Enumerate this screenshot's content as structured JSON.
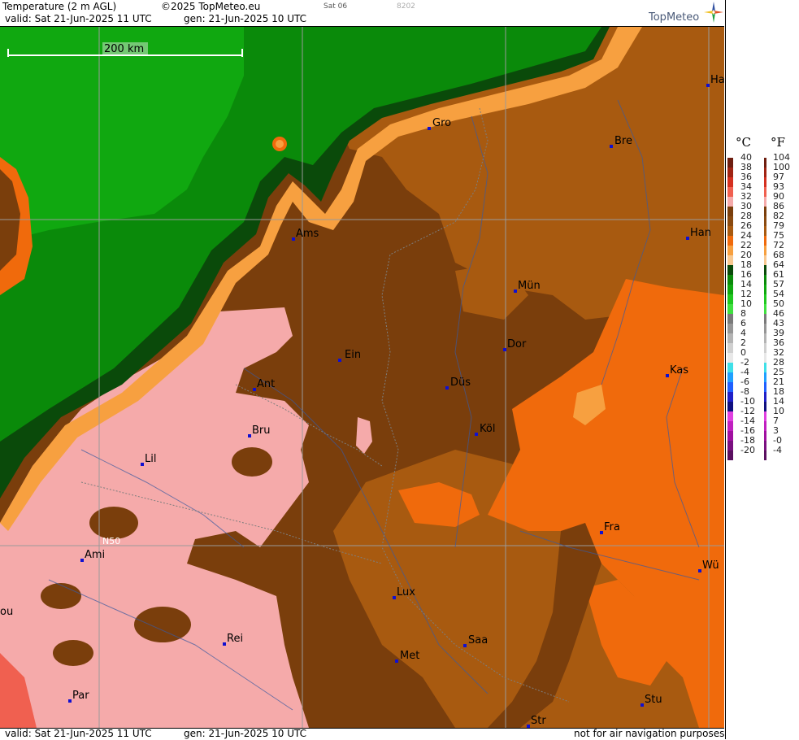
{
  "header": {
    "title": "Temperature (2 m AGL)",
    "copyright": "©2025 TopMeteo.eu",
    "model": "Sat 06",
    "code": "8202",
    "valid": "valid:  Sat  21-Jun-2025  11 UTC",
    "generated": "gen:  21-Jun-2025 10 UTC",
    "logo_text": "TopMeteo"
  },
  "map": {
    "scale_label": "200 km",
    "lat_label": "N50",
    "cities": [
      {
        "name": "Gro"
      },
      {
        "name": "Bre"
      },
      {
        "name": "Ha"
      },
      {
        "name": "Ams"
      },
      {
        "name": "Han"
      },
      {
        "name": "Mün"
      },
      {
        "name": "Ein"
      },
      {
        "name": "Dor"
      },
      {
        "name": "Ant"
      },
      {
        "name": "Düs"
      },
      {
        "name": "Kas"
      },
      {
        "name": "Bru"
      },
      {
        "name": "Köl"
      },
      {
        "name": "Lil"
      },
      {
        "name": "Fra"
      },
      {
        "name": "Ami"
      },
      {
        "name": "Wü"
      },
      {
        "name": "Lux"
      },
      {
        "name": "ou"
      },
      {
        "name": "Rei"
      },
      {
        "name": "Saa"
      },
      {
        "name": "Met"
      },
      {
        "name": "Par"
      },
      {
        "name": "Stu"
      },
      {
        "name": "Str"
      }
    ]
  },
  "footer": {
    "valid": "valid:  Sat  21-Jun-2025  11 UTC",
    "generated": "gen:  21-Jun-2025 10 UTC",
    "disclaimer": "not for air navigation purposes"
  },
  "legend": {
    "celsius_title": "°C",
    "fahrenheit_title": "°F",
    "celsius": [
      "40",
      "38",
      "36",
      "34",
      "32",
      "30",
      "28",
      "26",
      "24",
      "22",
      "20",
      "18",
      "16",
      "14",
      "12",
      "10",
      "8",
      "6",
      "4",
      "2",
      "0",
      "-2",
      "-4",
      "-6",
      "-8",
      "-10",
      "-12",
      "-14",
      "-16",
      "-18",
      "-20"
    ],
    "fahrenheit": [
      "104",
      "100",
      "97",
      "93",
      "90",
      "86",
      "82",
      "79",
      "75",
      "72",
      "68",
      "64",
      "61",
      "57",
      "54",
      "50",
      "46",
      "43",
      "39",
      "36",
      "32",
      "28",
      "25",
      "21",
      "18",
      "14",
      "10",
      "7",
      "3",
      "-0",
      "-4"
    ],
    "colors": [
      "#6e1e10",
      "#a02414",
      "#d43020",
      "#f06050",
      "#f5aaaa",
      "#7a3e0c",
      "#8a4a10",
      "#a85a10",
      "#f06a0c",
      "#f7a040",
      "#f8c890",
      "#0a4a0a",
      "#0a8a0a",
      "#10a810",
      "#20c820",
      "#40e040",
      "#7a7a7a",
      "#969696",
      "#b4b4b4",
      "#d0d0d0",
      "#e8e8e8",
      "#40e0e8",
      "#20a0ff",
      "#2060ff",
      "#2020c8",
      "#101080",
      "#e040e0",
      "#c020c0",
      "#a010a0",
      "#7a1080",
      "#5a1060"
    ]
  }
}
